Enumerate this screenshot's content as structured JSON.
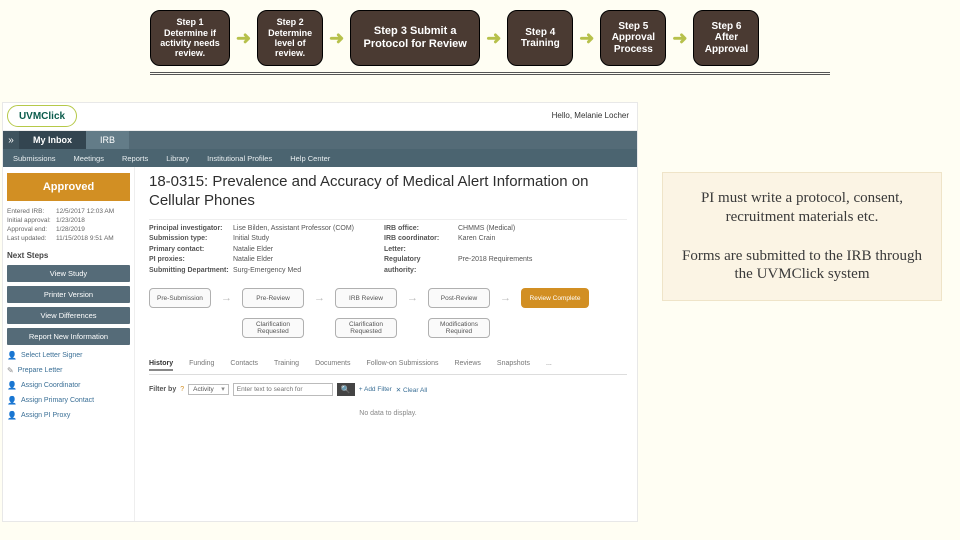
{
  "steps": {
    "s1": "Step 1 Determine if activity needs review.",
    "s2": "Step 2 Determine level of review.",
    "s3": "Step 3 Submit a Protocol for Review",
    "s4": "Step 4 Training",
    "s5": "Step 5 Approval Process",
    "s6": "Step 6 After Approval"
  },
  "app": {
    "logo": "UVMClick",
    "welcome": "Hello, Melanie Locher"
  },
  "top_tabs": {
    "inbox": "My Inbox",
    "irb": "IRB"
  },
  "sub_tabs": {
    "t1": "Submissions",
    "t2": "Meetings",
    "t3": "Reports",
    "t4": "Library",
    "t5": "Institutional Profiles",
    "t6": "Help Center"
  },
  "left": {
    "status": "Approved",
    "m1k": "Entered IRB:",
    "m1v": "12/5/2017 12:03 AM",
    "m2k": "Initial approval:",
    "m2v": "1/23/2018",
    "m3k": "Approval end:",
    "m3v": "1/28/2019",
    "m4k": "Last updated:",
    "m4v": "11/15/2018 9:51 AM",
    "next": "Next Steps",
    "b1": "View Study",
    "b2": "Printer Version",
    "b3": "View Differences",
    "b4": "Report New Information",
    "l1": "Select Letter Signer",
    "l2": "Prepare Letter",
    "l3": "Assign Coordinator",
    "l4": "Assign Primary Contact",
    "l5": "Assign PI Proxy"
  },
  "main": {
    "title": "18-0315: Prevalence and Accuracy of Medical Alert Information on Cellular Phones",
    "d1k": "Principal investigator:",
    "d1v": "Lise Bilden, Assistant Professor (COM)",
    "d2k": "Submission type:",
    "d2v": "Initial Study",
    "d3k": "Primary contact:",
    "d3v": "Natalie Elder",
    "d4k": "PI proxies:",
    "d4v": "Natalie Elder",
    "d5k": "Submitting Department:",
    "d5v": "Surg-Emergency Med",
    "d6k": "IRB office:",
    "d6v": "CHMMS (Medical)",
    "d7k": "IRB coordinator:",
    "d7v": "Karen Crain",
    "d8k": "Letter:",
    "d9k": "Regulatory authority:",
    "d9v": "Pre-2018 Requirements"
  },
  "workflow": {
    "n1": "Pre-Submission",
    "n2": "Pre-Review",
    "n3": "IRB Review",
    "n4": "Post-Review",
    "n5": "Review Complete",
    "s1": "Clarification Requested",
    "s2": "Clarification Requested",
    "s3": "Modifications Required"
  },
  "study_tabs": {
    "t1": "History",
    "t2": "Funding",
    "t3": "Contacts",
    "t4": "Training",
    "t5": "Documents",
    "t6": "Follow-on Submissions",
    "t7": "Reviews",
    "t8": "Snapshots",
    "t9": "..."
  },
  "filter": {
    "lbl": "Filter by",
    "sel": "Activity",
    "placeholder": "Enter text to search for",
    "go": "🔍",
    "add": "+ Add Filter",
    "clear": "✕ Clear All"
  },
  "nodata": "No data to display.",
  "info": {
    "p1": "PI must write a protocol, consent, recruitment materials etc.",
    "p2": "Forms are submitted to the IRB through the UVMClick system"
  }
}
